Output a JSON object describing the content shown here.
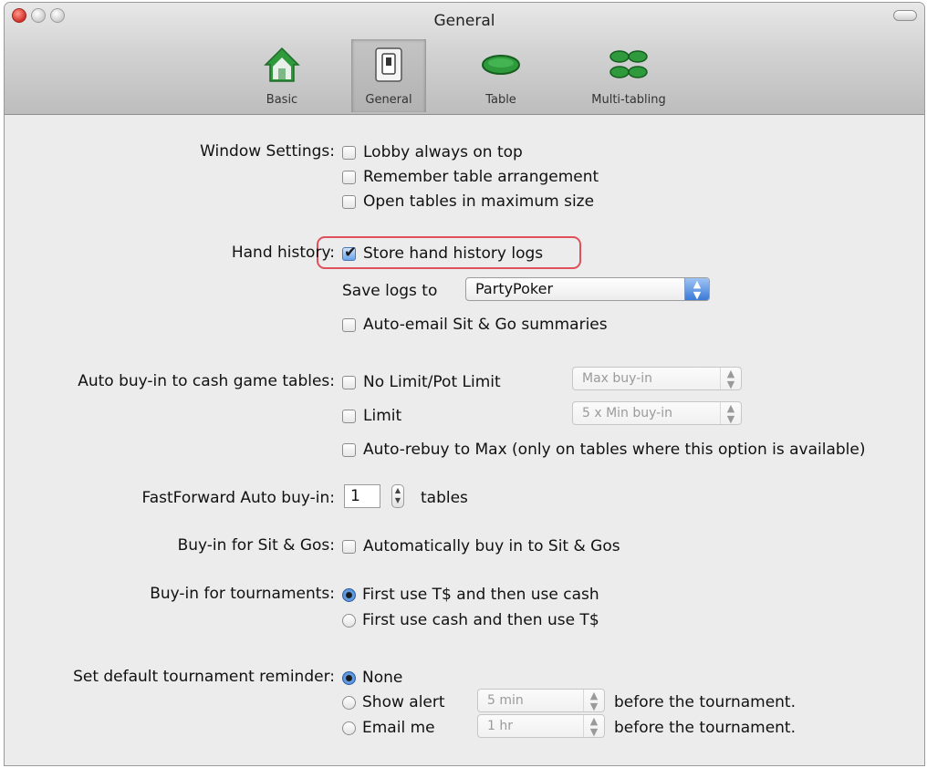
{
  "window": {
    "title": "General"
  },
  "toolbar": {
    "items": [
      {
        "label": "Basic",
        "icon": "house-icon"
      },
      {
        "label": "General",
        "icon": "switch-icon",
        "selected": true
      },
      {
        "label": "Table",
        "icon": "table-icon"
      },
      {
        "label": "Multi-tabling",
        "icon": "multi-tables-icon"
      }
    ]
  },
  "window_settings": {
    "label": "Window Settings:",
    "options": [
      {
        "label": "Lobby always on top",
        "checked": false
      },
      {
        "label": "Remember table arrangement",
        "checked": false
      },
      {
        "label": "Open tables in maximum size",
        "checked": false
      }
    ]
  },
  "hand_history": {
    "label": "Hand history:",
    "store_logs": {
      "label": "Store hand history logs",
      "checked": true
    },
    "save_logs_label": "Save logs to",
    "save_logs_value": "PartyPoker",
    "auto_email": {
      "label": "Auto-email Sit & Go summaries",
      "checked": false
    }
  },
  "auto_buyin": {
    "label": "Auto buy-in to cash game tables:",
    "no_limit": {
      "label": "No Limit/Pot Limit",
      "checked": false,
      "select_value": "Max buy-in"
    },
    "limit": {
      "label": "Limit",
      "checked": false,
      "select_value": "5 x Min buy-in"
    },
    "auto_rebuy": {
      "label": "Auto-rebuy to Max (only on tables where this option is available)",
      "checked": false
    }
  },
  "fastforward": {
    "label": "FastForward Auto buy-in:",
    "value": "1",
    "suffix": "tables"
  },
  "sitgo": {
    "label": "Buy-in for Sit & Gos:",
    "option": {
      "label": "Automatically buy in to Sit & Gos",
      "checked": false
    }
  },
  "tournaments": {
    "label": "Buy-in for tournaments:",
    "options": [
      {
        "label": "First use T$ and then use cash",
        "selected": true
      },
      {
        "label": "First use cash and then use T$",
        "selected": false
      }
    ]
  },
  "reminder": {
    "label": "Set default tournament reminder:",
    "none": {
      "label": "None",
      "selected": true
    },
    "show_alert": {
      "label": "Show alert",
      "selected": false,
      "select_value": "5 min",
      "suffix": "before the tournament."
    },
    "email_me": {
      "label": "Email me",
      "selected": false,
      "select_value": "1 hr",
      "suffix": "before the tournament."
    }
  },
  "colors": {
    "highlight": "#e0505a",
    "accent": "#3b7ad8",
    "toolbar_green": "#2f9a3c"
  }
}
